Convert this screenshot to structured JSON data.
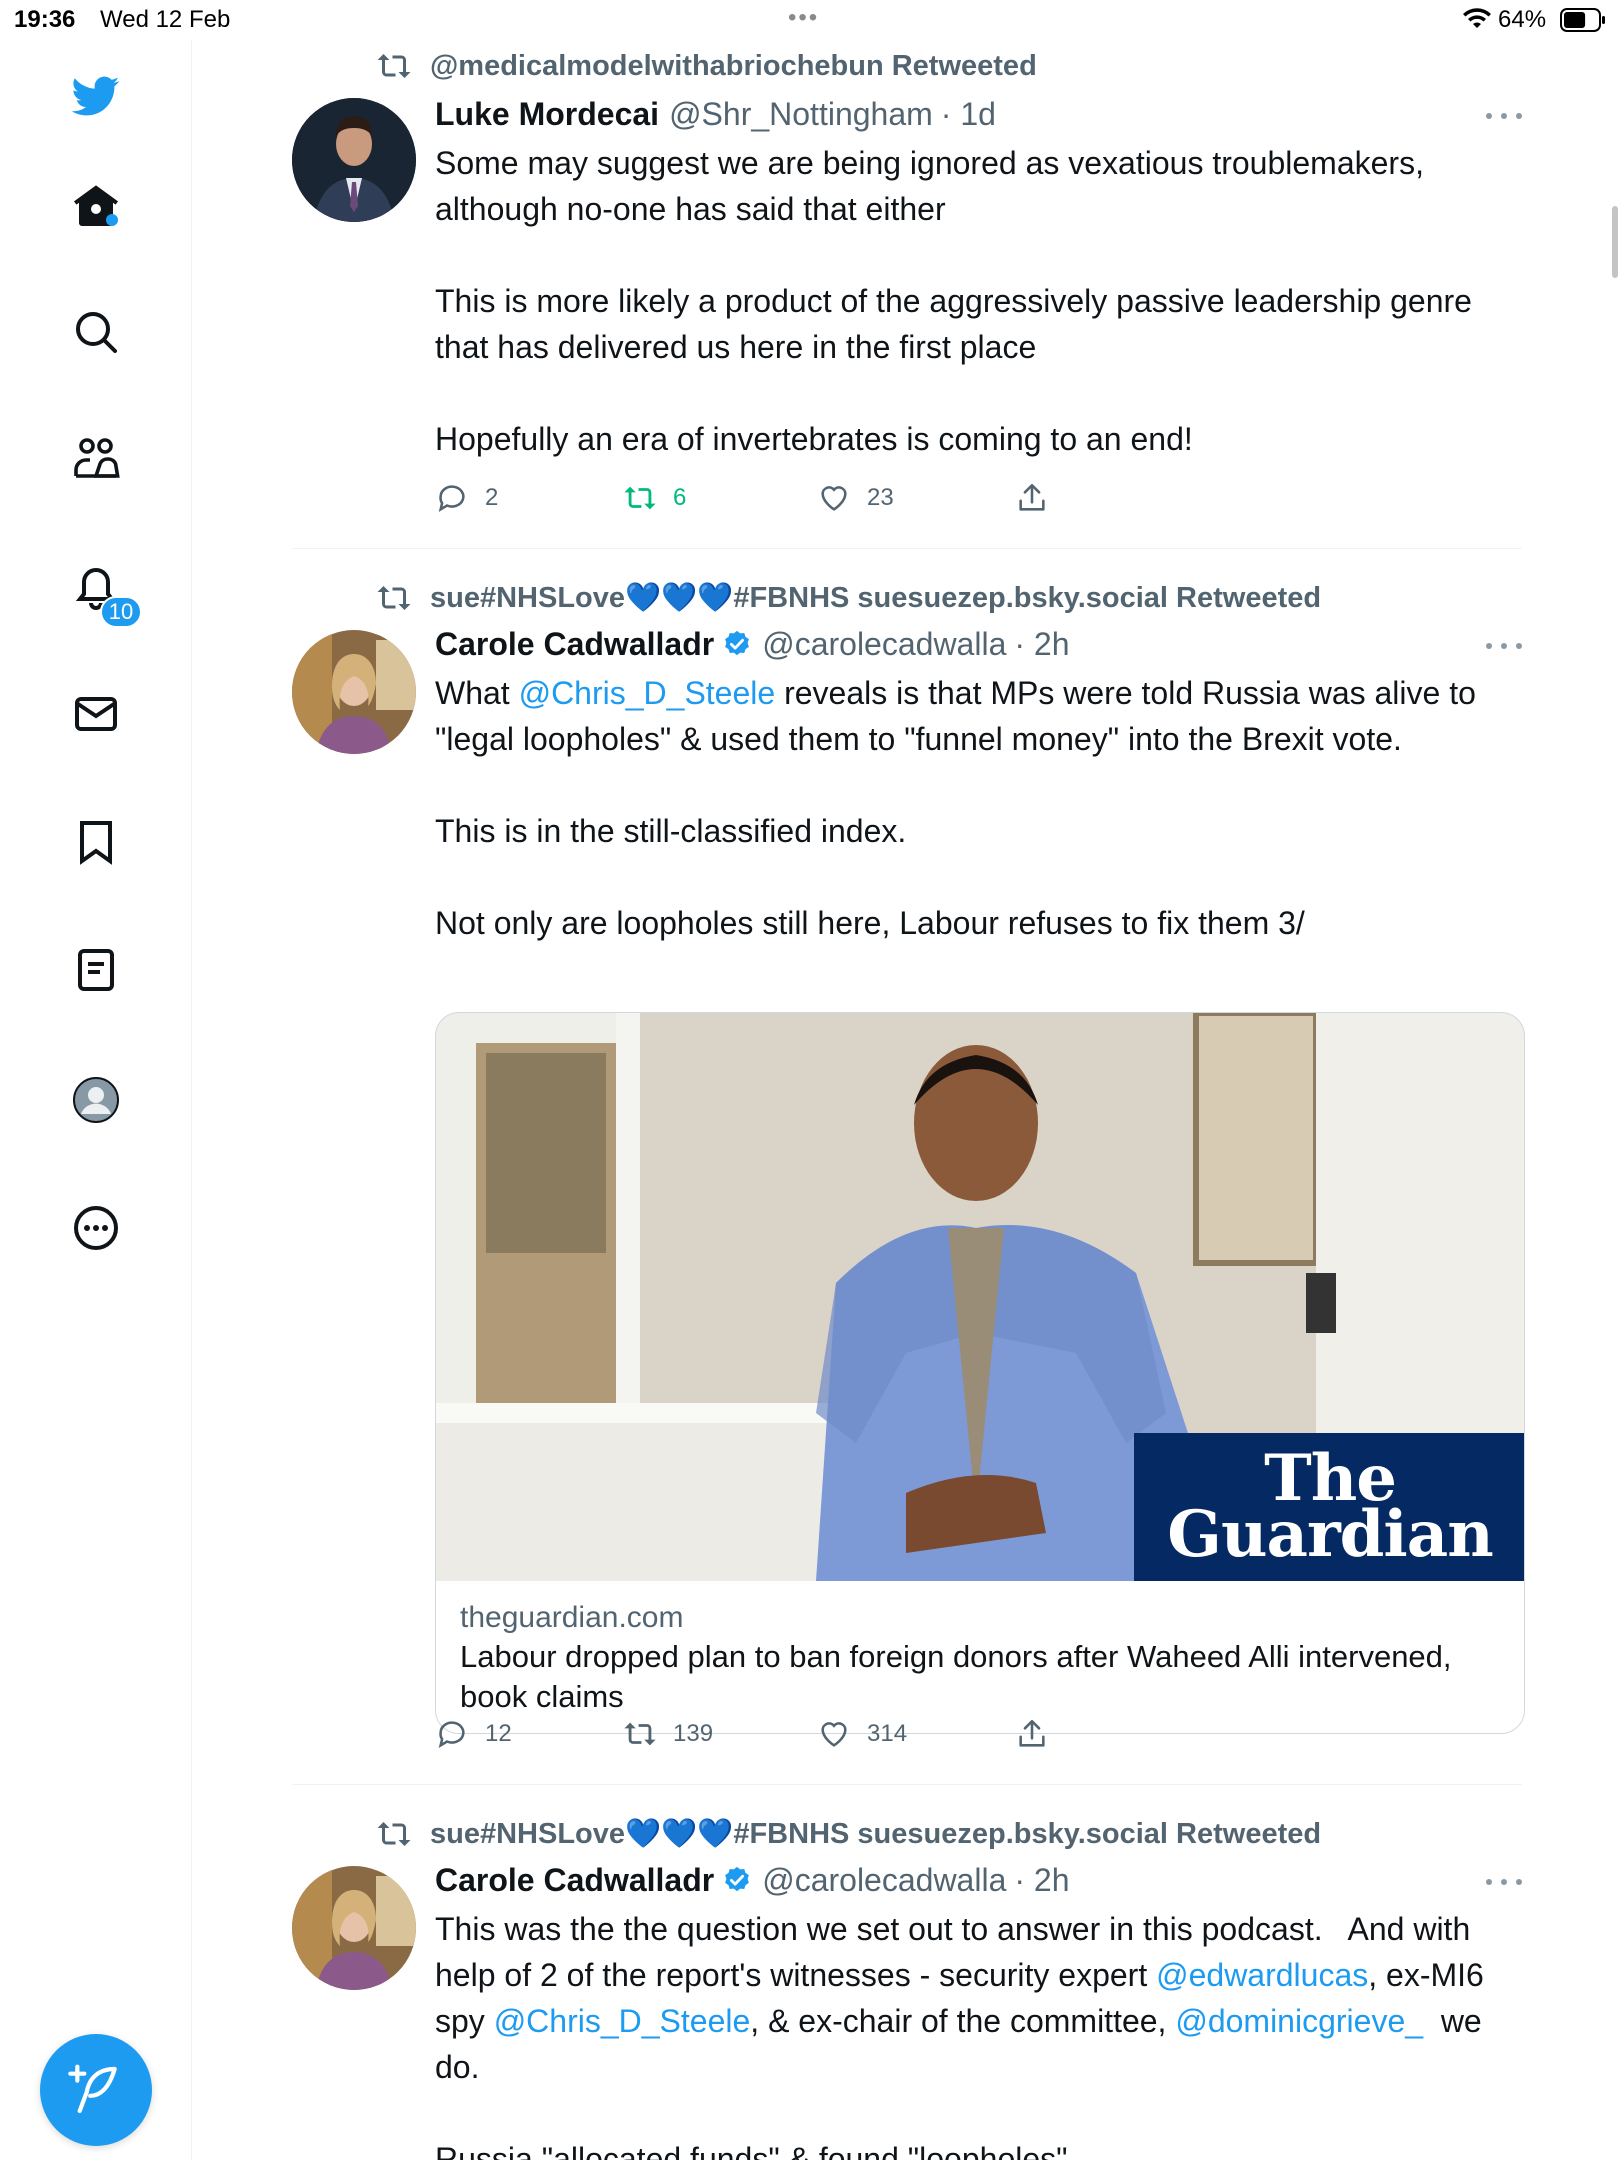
{
  "status_bar": {
    "time": "19:36",
    "date": "Wed 12 Feb",
    "battery_percent": "64%",
    "battery_level": 0.64
  },
  "sidebar": {
    "items": [
      {
        "name": "twitter-logo"
      },
      {
        "name": "home"
      },
      {
        "name": "explore"
      },
      {
        "name": "communities"
      },
      {
        "name": "notifications",
        "badge": "10"
      },
      {
        "name": "messages"
      },
      {
        "name": "bookmarks"
      },
      {
        "name": "lists"
      },
      {
        "name": "profile"
      },
      {
        "name": "more"
      }
    ],
    "compose_icon": "compose-tweet-icon"
  },
  "colors": {
    "accent": "#1d9bf0",
    "retweet_green": "#00ba7c",
    "muted": "#536471",
    "guardian_blue": "#052962"
  },
  "tweets": [
    {
      "retweeted_by": "@medicalmodelwithabriochebun Retweeted",
      "name": "Luke Mordecai",
      "handle": "@Shr_Nottingham",
      "time": "· 1d",
      "body": "Some may suggest we are being ignored as vexatious troublemakers, although no-one has said that either\n\nThis is more likely a product of the aggressively passive leadership genre that has delivered us here in the first place\n\nHopefully an era of invertebrates is coming to an end!",
      "replies": "2",
      "retweets": "6",
      "likes": "23"
    },
    {
      "retweeted_by": "sue#NHSLove💙💙💙#FBNHS suesuezep.bsky.social Retweeted",
      "name": "Carole Cadwalladr",
      "handle": "@carolecadwalla",
      "time": "· 2h",
      "body_parts": [
        "What ",
        "@Chris_D_Steele",
        " reveals is that MPs were told Russia was alive to \"legal loopholes\" & used them to \"funnel money\" into the Brexit vote.\n\nThis is in the still-classified index.\n\nNot only are loopholes still here, Labour refuses to fix them 3/"
      ],
      "card": {
        "logo_line1": "The",
        "logo_line2": "Guardian",
        "domain": "theguardian.com",
        "title": "Labour dropped plan to ban foreign donors after Waheed Alli intervened, book claims"
      },
      "replies": "12",
      "retweets": "139",
      "likes": "314"
    },
    {
      "retweeted_by": "sue#NHSLove💙💙💙#FBNHS suesuezep.bsky.social Retweeted",
      "name": "Carole Cadwalladr",
      "handle": "@carolecadwalla",
      "time": "· 2h",
      "body_parts": [
        "This was the the question we set out to answer in this podcast.   And with help of 2 of the report's witnesses - security expert ",
        "@edwardlucas",
        ", ex-MI6 spy ",
        "@Chris_D_Steele",
        ", & ex-chair of the committee, ",
        "@dominicgrieve_",
        "  we do."
      ],
      "body_cutoff": "Russia \"allocated funds\" & found \"loopholes\""
    }
  ]
}
